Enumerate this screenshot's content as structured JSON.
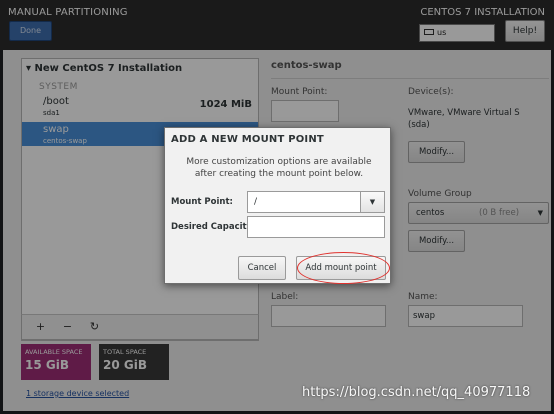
{
  "header": {
    "title": "MANUAL PARTITIONING",
    "done_label": "Done",
    "installer_title": "CENTOS 7 INSTALLATION",
    "keyboard_layout": "us",
    "help_label": "Help!"
  },
  "left_panel": {
    "install_title": "▾ New CentOS 7 Installation",
    "system_label": "SYSTEM",
    "mount_points": [
      {
        "name": "/boot",
        "device": "sda1",
        "size": "1024 MiB",
        "selected": false
      },
      {
        "name": "swap",
        "device": "centos-swap",
        "size": "",
        "selected": true
      }
    ],
    "toolbar": {
      "add_label": "+",
      "remove_label": "−",
      "refresh_label": "↻"
    }
  },
  "space": {
    "available_label": "AVAILABLE SPACE",
    "available_value": "15 GiB",
    "total_label": "TOTAL SPACE",
    "total_value": "20 GiB"
  },
  "storage_link": "1 storage device selected",
  "right_panel": {
    "title": "centos-swap",
    "mount_point_label": "Mount Point:",
    "devices_label": "Device(s):",
    "devices_value": "VMware, VMware Virtual S",
    "devices_sub": "(sda)",
    "modify_label": "Modify...",
    "volume_group_label": "Volume Group",
    "volume_group_value": "centos",
    "volume_group_free": "(0 B free)",
    "label_label": "Label:",
    "name_label": "Name:",
    "name_value": "swap"
  },
  "dialog": {
    "title": "ADD A NEW MOUNT POINT",
    "description": "More customization options are available after creating the mount point below.",
    "mount_point_label": "Mount Point:",
    "mount_point_value": "/",
    "capacity_label": "Desired Capacity:",
    "capacity_value": "",
    "cancel_label": "Cancel",
    "add_label": "Add mount point"
  },
  "watermark": "https://blog.csdn.net/qq_40977118",
  "colors": {
    "accent": "#4a90d9",
    "available_space": "#9e2d77",
    "total_space": "#3a3a3a",
    "highlight_circle": "#e0322e"
  }
}
